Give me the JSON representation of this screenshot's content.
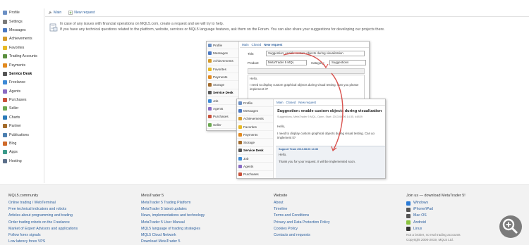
{
  "sidebar": {
    "items": [
      {
        "label": "Profile",
        "icon": "profile-icon",
        "color": "#6b8fc4"
      },
      {
        "label": "Settings",
        "icon": "gear-icon",
        "color": "#7a7a7a"
      },
      {
        "label": "Messages",
        "icon": "envelope-icon",
        "color": "#4a78c2"
      },
      {
        "label": "Achievements",
        "icon": "achievements-icon",
        "color": "#d59a2a"
      },
      {
        "label": "Favorites",
        "icon": "star-icon",
        "color": "#e8b923"
      },
      {
        "label": "Trading Accounts",
        "icon": "accounts-icon",
        "color": "#5a8f3e"
      },
      {
        "label": "Payments",
        "icon": "payments-icon",
        "color": "#e28a1f"
      },
      {
        "label": "Service Desk",
        "icon": "service-desk-icon",
        "color": "#555555",
        "active": true
      },
      {
        "label": "Freelance",
        "icon": "freelance-icon",
        "color": "#3d8ad6"
      },
      {
        "label": "Agents",
        "icon": "agents-icon",
        "color": "#8a6bc4"
      },
      {
        "label": "Purchases",
        "icon": "purchases-icon",
        "color": "#c9513a"
      },
      {
        "label": "Seller",
        "icon": "seller-icon",
        "color": "#6aa84f"
      },
      {
        "label": "Charts",
        "icon": "charts-icon",
        "color": "#2b7bb9"
      },
      {
        "label": "Partner",
        "icon": "partner-icon",
        "color": "#a36b2b"
      },
      {
        "label": "Publications",
        "icon": "publications-icon",
        "color": "#4c7fb0"
      },
      {
        "label": "Blog",
        "icon": "blog-icon",
        "color": "#d06a2a"
      },
      {
        "label": "Apps",
        "icon": "apps-icon",
        "color": "#3a9a8a"
      },
      {
        "label": "Hosting",
        "icon": "hosting-icon",
        "color": "#5b6f8a"
      }
    ]
  },
  "topbar": {
    "main_label": "Main",
    "new_request_label": "New request"
  },
  "notice": {
    "line1": "In case of any issues with financial operations on MQL5.com, create a request and we will try to help.",
    "line2": "If you have any technical questions related to the platform, website, services or MQL5 language features, ask them on the Forum. You can also share your suggestions for developing our projects there."
  },
  "mock1": {
    "items": [
      "Profile",
      "Messages",
      "Achievements",
      "Favorites",
      "Payments",
      "Storage",
      "Service Desk",
      "Job",
      "Agents",
      "Purchases",
      "Seller"
    ],
    "active": "Service Desk",
    "top": [
      "Main",
      "Closed",
      "New request"
    ],
    "title_label": "Title:",
    "title_value": "Suggestion: enable custom objects during visualization",
    "product_label": "Product:",
    "product_value": "MetaTrader 5 MQL",
    "category_label": "Category:",
    "category_value": "Suggestions",
    "body_hello": "Hello,",
    "body_text1": "I need to display custom graphical objects during visual testing. Can you please",
    "body_text2": "implement it?"
  },
  "mock2": {
    "items": [
      "Profile",
      "Messages",
      "Achievements",
      "Favorites",
      "Payments",
      "Storage",
      "Service Desk",
      "Job",
      "Agents",
      "Purchases"
    ],
    "active": "Service Desk",
    "top": [
      "Main",
      "Closed",
      "New request"
    ],
    "title": "Suggestion: enable custom objects during visualization",
    "meta": "Suggestions, MetaTrader 5 MQL, Open, Start: 2013.08.06 14:35, #4839",
    "hello": "Hello,",
    "text1": "I need to display custom graphical objects during visual testing. Can yo",
    "text2": "implement it?",
    "answer_from": "Support Team 2013.08.06 14:36",
    "answer_hello": "Hello,",
    "answer_text": "Thank you for your request. It will be implemented soon."
  },
  "footer": {
    "col1": {
      "heading": "MQL5.community",
      "links": [
        "Online trading / WebTerminal",
        "Free technical indicators and robots",
        "Articles about programming and trading",
        "Order trading robots on the Freelance",
        "Market of Expert Advisors and applications",
        "Follow forex signals",
        "Low latency forex VPS"
      ]
    },
    "col2": {
      "heading": "MetaTrader 5",
      "links": [
        "MetaTrader 5 Trading Platform",
        "MetaTrader 5 latest updates",
        "News, implementations and technology",
        "MetaTrader 5 User Manual",
        "MQL5 language of trading strategies",
        "MQL5 Cloud Network",
        "Download MetaTrader 5"
      ]
    },
    "col3": {
      "heading": "Website",
      "links": [
        "About",
        "Timeline",
        "Terms and Conditions",
        "Privacy and Data Protection Policy",
        "Cookies Policy",
        "Contacts and requests"
      ]
    },
    "col4": {
      "heading": "Join us — download MetaTrader 5!",
      "links": [
        {
          "label": "Windows",
          "icon": "windows-icon",
          "color": "#2b7bd6"
        },
        {
          "label": "iPhone/iPad",
          "icon": "apple-icon",
          "color": "#555555"
        },
        {
          "label": "Mac OS",
          "icon": "mac-icon",
          "color": "#555555"
        },
        {
          "label": "Android",
          "icon": "android-icon",
          "color": "#8ac43f"
        },
        {
          "label": "Linux",
          "icon": "linux-icon",
          "color": "#333333"
        }
      ],
      "note1": "Not a broker, no real trading accounts",
      "note2": "Copyright 2000-2019, MQL5 Ltd."
    }
  },
  "colors": {
    "link": "#2b5f9e",
    "arrow": "#d9534f",
    "footer_bg": "#f2f2f2"
  }
}
